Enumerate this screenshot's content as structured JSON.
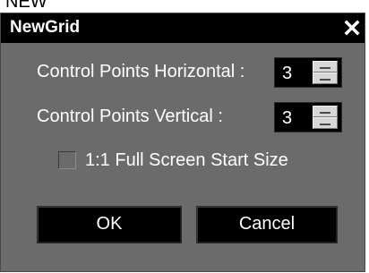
{
  "background_caption": "NEW",
  "dialog": {
    "title": "NewGrid",
    "close_icon": "close-icon"
  },
  "fields": {
    "horizontal": {
      "label": "Control Points Horizontal :",
      "value": "3"
    },
    "vertical": {
      "label": "Control Points Vertical :",
      "value": "3"
    }
  },
  "checkbox": {
    "label": "1:1 Full Screen Start Size",
    "checked": false
  },
  "buttons": {
    "ok_label": "OK",
    "cancel_label": "Cancel"
  },
  "colors": {
    "dialog_body": "#6b6b6b",
    "titlebar": "#000000",
    "text": "#ffffff",
    "control_bg": "#000000",
    "spinner": "#d6d6d6"
  }
}
